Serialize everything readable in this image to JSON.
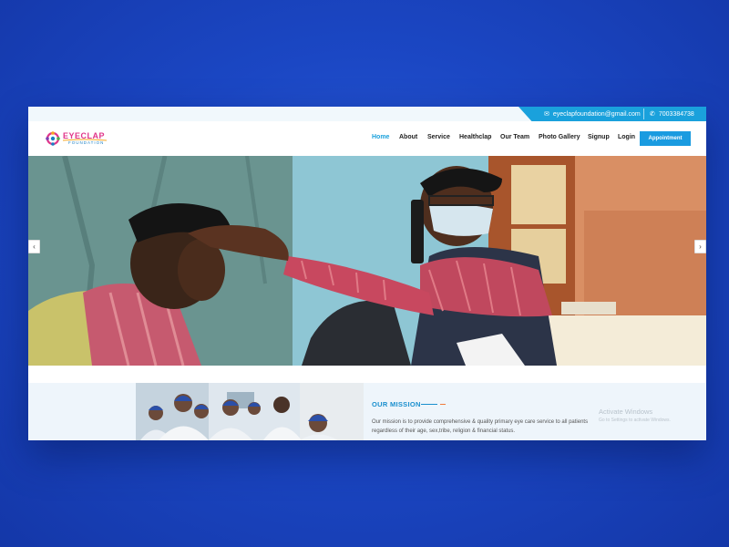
{
  "topbar": {
    "email": "eyeclapfoundation@gmail.com",
    "phone": "7003384738",
    "email_icon": "envelope-icon",
    "phone_icon": "phone-icon"
  },
  "logo": {
    "name": "EYECLAP",
    "sub": "FOUNDATION"
  },
  "nav": {
    "items": [
      "Home",
      "About",
      "Service",
      "Healthclap",
      "Our Team",
      "Photo Gallery",
      "Signup",
      "Login"
    ],
    "active": "Home",
    "appointment": "Appointment"
  },
  "hero": {
    "prev_icon": "‹",
    "next_icon": "›"
  },
  "mission": {
    "title": "OUR MISSION",
    "text": "Our mission is to provide comprehensive & quality primary eye care service to all patients regardless of their age, sex,tribe, religion & financial status."
  },
  "watermark": {
    "title": "Activate Windows",
    "sub": "Go to Settings to activate Windows."
  },
  "colors": {
    "accent": "#1aa1dc",
    "button": "#1a9be0",
    "page_bg": "#1b47c4",
    "mission_accent": "#1a8fce",
    "mission_accent2": "#f07a3c"
  }
}
